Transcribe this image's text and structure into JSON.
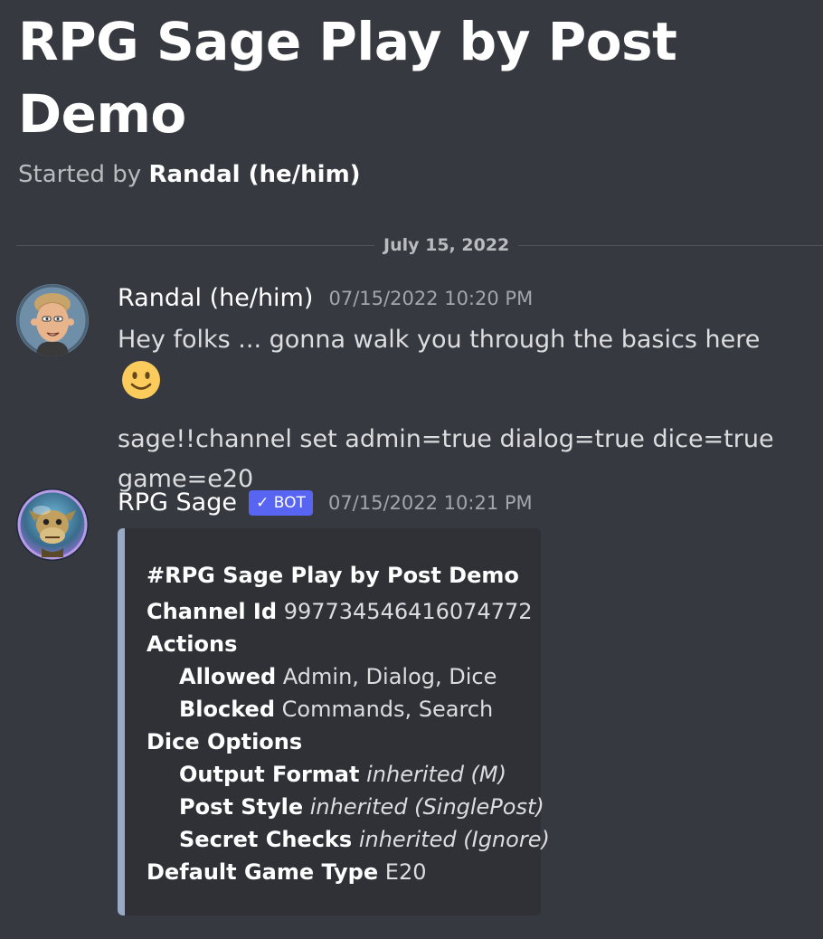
{
  "thread": {
    "title": "RPG Sage Play by Post Demo",
    "started_by_prefix": "Started by",
    "started_by_author": "Randal (he/him)"
  },
  "date_divider": "July 15, 2022",
  "messages": [
    {
      "username": "Randal (he/him)",
      "timestamp": "07/15/2022 10:20 PM",
      "line1": "Hey folks ... gonna walk you through the basics here",
      "emoji": "slightly-smiling-face",
      "line2": "sage!!channel set admin=true dialog=true dice=true game=e20"
    },
    {
      "username": "RPG Sage",
      "bot_tag": "✓ BOT",
      "timestamp": "07/15/2022 10:21 PM",
      "embed": {
        "title": "#RPG Sage Play by Post Demo",
        "channel_id_label": "Channel Id",
        "channel_id_value": "997734546416074772",
        "actions_label": "Actions",
        "allowed_label": "Allowed",
        "allowed_value": "Admin, Dialog, Dice",
        "blocked_label": "Blocked",
        "blocked_value": "Commands, Search",
        "dice_options_label": "Dice Options",
        "output_format_label": "Output Format",
        "output_format_value": "inherited (M)",
        "post_style_label": "Post Style",
        "post_style_value": "inherited (SinglePost)",
        "secret_checks_label": "Secret Checks",
        "secret_checks_value": "inherited (Ignore)",
        "default_game_type_label": "Default Game Type",
        "default_game_type_value": "E20"
      }
    }
  ],
  "colors": {
    "background": "#36393f",
    "embed_background": "#2f3136",
    "embed_accent": "#9aaac6",
    "bot_tag": "#5865f2"
  }
}
